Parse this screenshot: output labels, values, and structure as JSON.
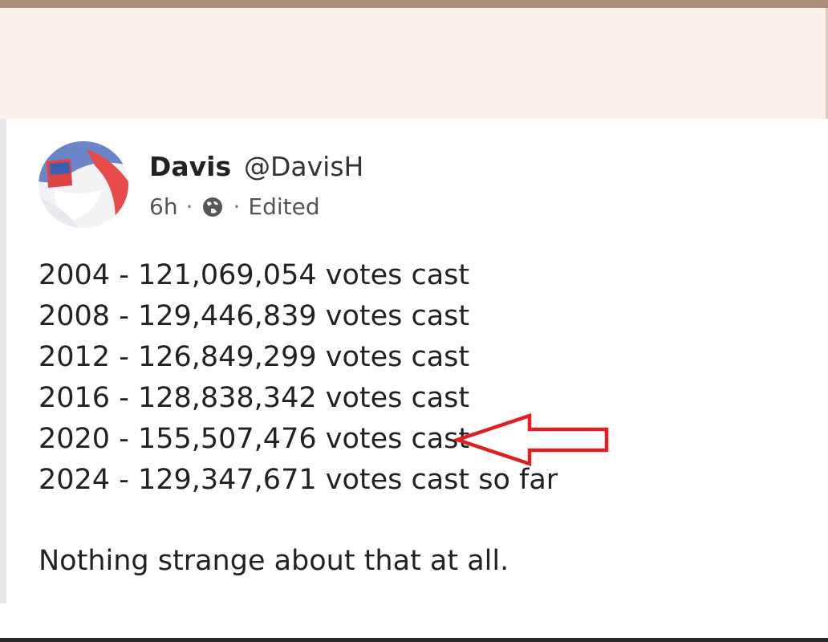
{
  "post": {
    "author_name": "Davis",
    "author_handle": "@DavisH",
    "time_ago": "6h",
    "separator": "·",
    "edited_label": "Edited",
    "visibility_icon": "globe-icon",
    "lines": [
      "2004 - 121,069,054 votes cast",
      "2008 - 129,446,839 votes cast",
      "2012 - 126,849,299 votes cast",
      "2016 - 128,838,342 votes cast",
      "2020 - 155,507,476 votes cast",
      "2024 - 129,347,671 votes cast so far"
    ],
    "closing": "Nothing strange about that at all."
  },
  "annotation": {
    "type": "arrow-pointing-left",
    "color": "#e02020",
    "target_line": 5
  },
  "colors": {
    "top_bar": "#ad8f7e",
    "header_band": "#faf1eb",
    "text": "#222222"
  }
}
